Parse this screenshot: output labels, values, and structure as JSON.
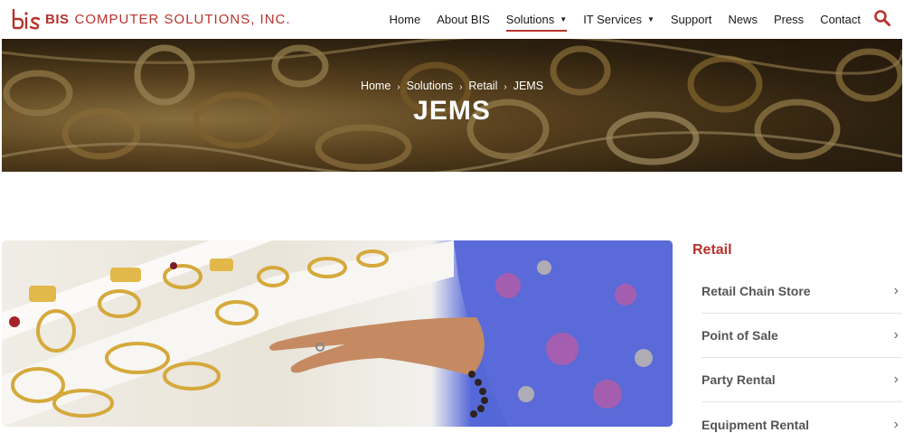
{
  "brand": {
    "name_bold": "BIS",
    "name_light": "COMPUTER SOLUTIONS, INC.",
    "color": "#b8322c"
  },
  "nav": {
    "items": [
      {
        "label": "Home"
      },
      {
        "label": "About BIS"
      },
      {
        "label": "Solutions",
        "dropdown": true,
        "active": true
      },
      {
        "label": "IT Services",
        "dropdown": true
      },
      {
        "label": "Support"
      },
      {
        "label": "News"
      },
      {
        "label": "Press"
      },
      {
        "label": "Contact"
      }
    ],
    "search_icon": "search-icon"
  },
  "hero": {
    "breadcrumb": [
      "Home",
      "Solutions",
      "Retail",
      "JEMS"
    ],
    "title": "JEMS"
  },
  "sidebar": {
    "title": "Retail",
    "items": [
      {
        "label": "Retail Chain Store"
      },
      {
        "label": "Point of Sale"
      },
      {
        "label": "Party Rental"
      },
      {
        "label": "Equipment Rental"
      }
    ]
  }
}
